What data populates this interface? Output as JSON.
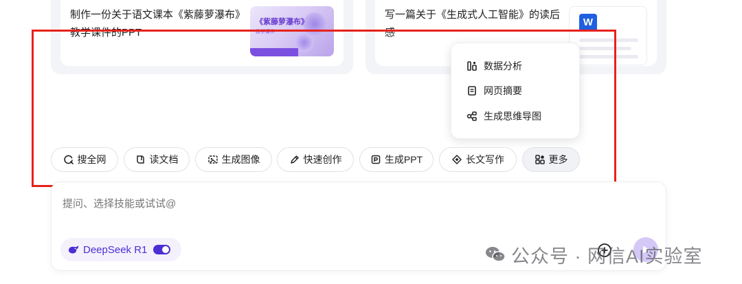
{
  "suggestions": [
    {
      "text": "制作一份关于语文课本《紫藤萝瀑布》教学课件的PPT",
      "thumb": {
        "title": "《紫藤萝瀑布》",
        "subtitle": "教学课件"
      }
    },
    {
      "text": "写一篇关于《生成式人工智能》的读后感",
      "thumb": {
        "badge": "W"
      }
    }
  ],
  "more_menu": {
    "items": [
      {
        "label": "数据分析",
        "icon": "data-analysis-icon"
      },
      {
        "label": "网页摘要",
        "icon": "web-summary-icon"
      },
      {
        "label": "生成思维导图",
        "icon": "mind-map-icon"
      }
    ]
  },
  "toolbar": {
    "chips": [
      {
        "label": "搜全网",
        "icon": "web-search-icon"
      },
      {
        "label": "读文档",
        "icon": "read-doc-icon"
      },
      {
        "label": "生成图像",
        "icon": "image-gen-icon"
      },
      {
        "label": "快速创作",
        "icon": "quick-create-icon"
      },
      {
        "label": "生成PPT",
        "icon": "ppt-gen-icon"
      },
      {
        "label": "长文写作",
        "icon": "long-writing-icon"
      },
      {
        "label": "更多",
        "icon": "more-grid-icon"
      }
    ]
  },
  "composer": {
    "placeholder": "提问、选择技能或试试@",
    "model_label": "DeepSeek R1",
    "model_enabled": true,
    "accent": "#4b2fd4"
  },
  "watermark": {
    "text": "公众号 · 网信AI实验室"
  },
  "colors": {
    "highlight_box": "#e8211b",
    "send_button": "#d4c8f7"
  }
}
